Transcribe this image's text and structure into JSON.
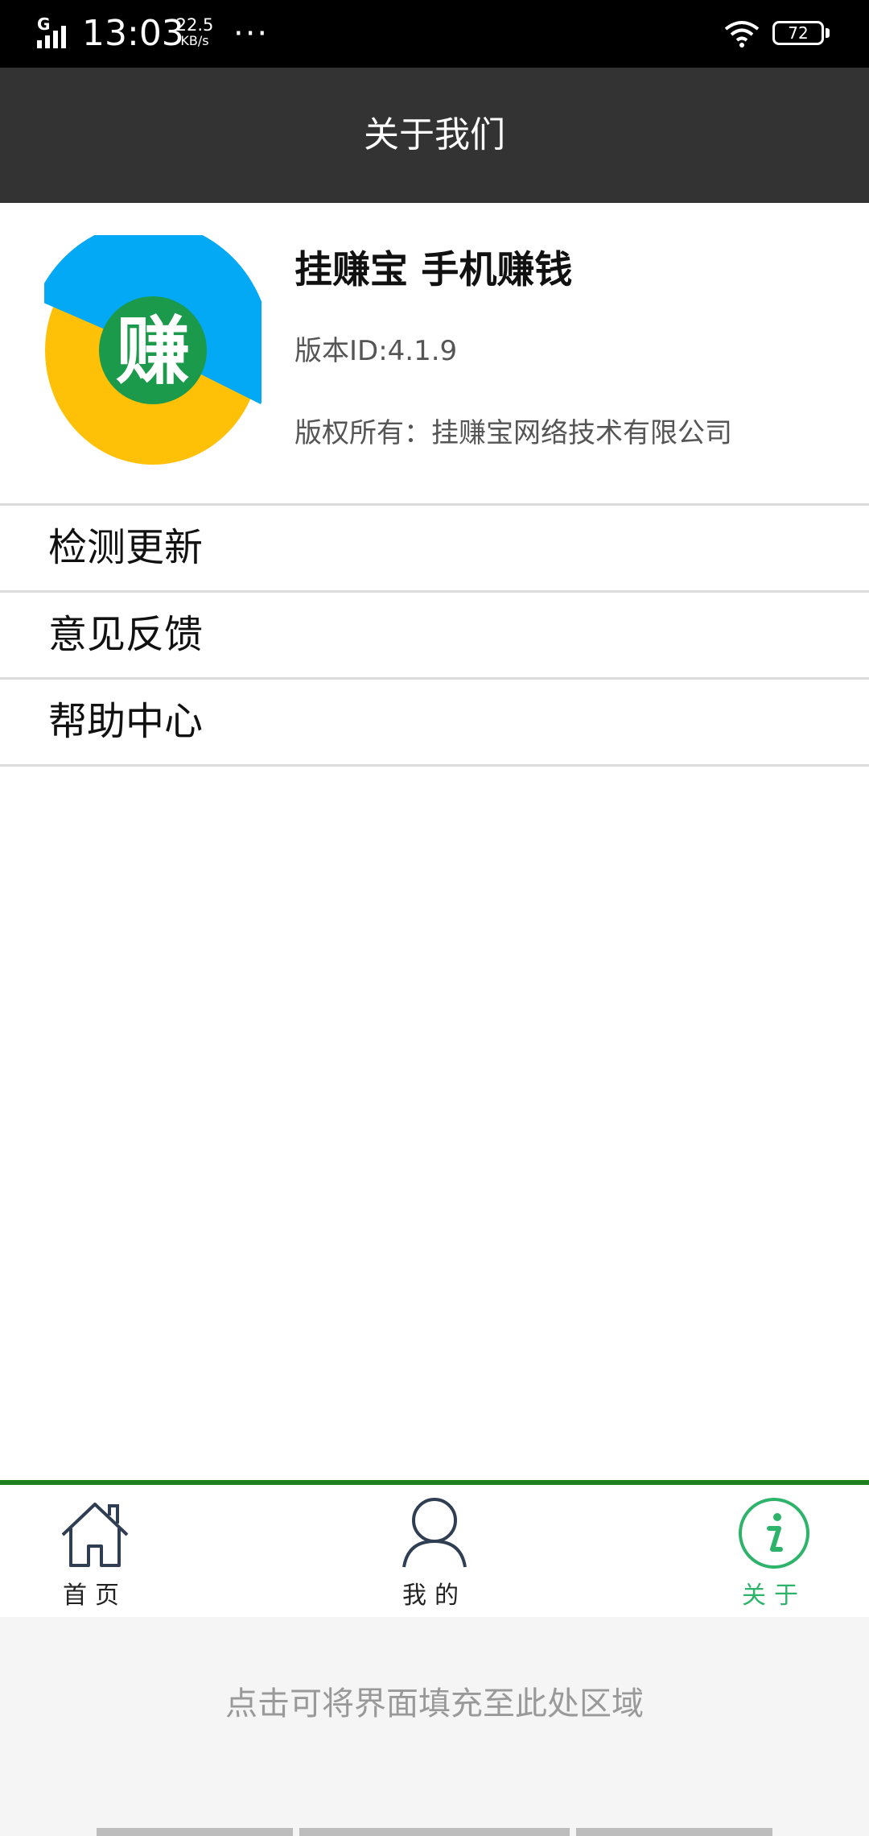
{
  "status_bar": {
    "network": "G",
    "time": "13:03",
    "speed_value": "22.5",
    "speed_unit": "KB/s",
    "more": "···",
    "battery": "72"
  },
  "header": {
    "title": "关于我们"
  },
  "app_info": {
    "logo_char": "赚",
    "name": "挂赚宝 手机赚钱",
    "version": "版本ID:4.1.9",
    "copyright": "版权所有：挂赚宝网络技术有限公司",
    "logo_colors": {
      "blue": "#03a9f4",
      "yellow": "#ffc107",
      "green": "#1a9a4a"
    }
  },
  "menu": {
    "items": [
      {
        "label": "检测更新"
      },
      {
        "label": "意见反馈"
      },
      {
        "label": "帮助中心"
      }
    ]
  },
  "bottom_nav": {
    "tabs": [
      {
        "label": "首页",
        "icon": "home-icon",
        "active": false
      },
      {
        "label": "我的",
        "icon": "user-icon",
        "active": false
      },
      {
        "label": "关于",
        "icon": "info-icon",
        "active": true
      }
    ],
    "accent_color": "#2db36a",
    "border_color": "#1e7f1e"
  },
  "fill_area": {
    "hint": "点击可将界面填充至此处区域"
  }
}
